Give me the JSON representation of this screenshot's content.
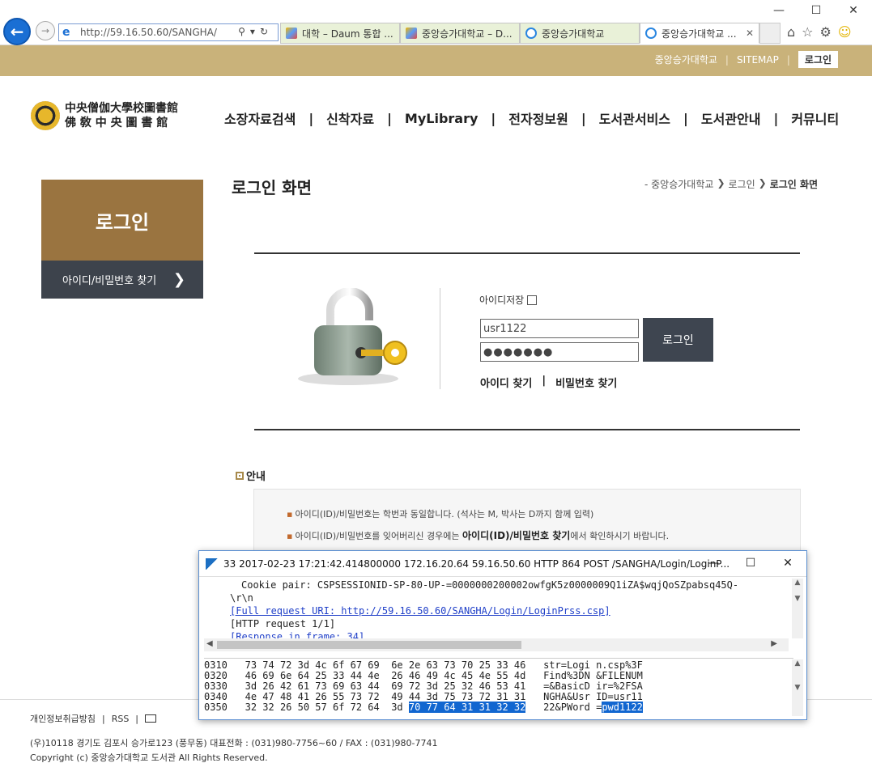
{
  "browser": {
    "url": "http://59.16.50.60/SANGHA/",
    "tabs": [
      {
        "label": "대학 – Daum 통합 ..."
      },
      {
        "label": "중앙승가대학교 – D..."
      },
      {
        "label": "중앙승가대학교"
      },
      {
        "label": "중앙승가대학교 ..."
      }
    ]
  },
  "topbar": {
    "university": "중앙승가대학교",
    "sitemap": "SITEMAP",
    "login": "로그인"
  },
  "logo": {
    "line1": "中央僧伽大學校圖書館",
    "line2": "佛 敎 中 央 圖 書 館"
  },
  "nav": [
    "소장자료검색",
    "신착자료",
    "MyLibrary",
    "전자정보원",
    "도서관서비스",
    "도서관안내",
    "커뮤니티"
  ],
  "side": {
    "title": "로그인",
    "item": "아이디/비밀번호 찾기"
  },
  "page": {
    "title": "로그인 화면",
    "breadcrumb": [
      "- 중앙승가대학교",
      "로그인",
      "로그인 화면"
    ]
  },
  "login_form": {
    "save_id_label": "아이디저장",
    "user_id": "usr1122",
    "password_masked": "●●●●●●●",
    "submit": "로그인",
    "find_id": "아이디 찾기",
    "find_pw": "비밀번호 찾기"
  },
  "notice": {
    "title": "안내",
    "line1": "아이디(ID)/비밀번호는 학번과 동일합니다. (석사는 M, 박사는 D까지 함께 입력)",
    "line2_pre": "아이디(ID)/비밀번호를 잊어버리신 경우에는 ",
    "line2_bold": "아이디(ID)/비밀번호 찾기",
    "line2_post": "에서 확인하시기 바랍니다."
  },
  "footer": {
    "privacy": "개인정보취급방침",
    "rss": "RSS",
    "address": "(우)10118 경기도 김포시 승가로123 (풍무동) 대표전화 : (031)980-7756~60 / FAX : (031)980-7741",
    "copyright": "Copyright (c) 중앙승가대학교 도서관 All Rights Reserved."
  },
  "packet_window": {
    "title": "33 2017-02-23 17:21:42.414800000 172.16.20.64 59.16.50.60 HTTP 864 POST /SANGHA/Login/LoginP...",
    "detail_lines": [
      "Cookie pair: CSPSESSIONID-SP-80-UP-=0000000200002owfgK5z0000009Q1iZA$wqjQoSZpabsq45Q-",
      "\\r\\n",
      "[Full request URI: http://59.16.50.60/SANGHA/Login/LoginPrss.csp]",
      "[HTTP request 1/1]",
      "[Response in frame: 34]"
    ],
    "hex_rows": [
      {
        "offset": "0310",
        "bytes": "73 74 72 3d 4c 6f 67 69  6e 2e 63 73 70 25 33 46",
        "ascii": "str=Logi n.csp%3F"
      },
      {
        "offset": "0320",
        "bytes": "46 69 6e 64 25 33 44 4e  26 46 49 4c 45 4e 55 4d",
        "ascii": "Find%3DN &FILENUM"
      },
      {
        "offset": "0330",
        "bytes": "3d 26 42 61 73 69 63 44  69 72 3d 25 32 46 53 41",
        "ascii": "=&BasicD ir=%2FSA"
      },
      {
        "offset": "0340",
        "bytes": "4e 47 48 41 26 55 73 72  49 44 3d 75 73 72 31 31",
        "ascii": "NGHA&Usr ID=usr11"
      },
      {
        "offset": "0350",
        "bytes_pre": "32 32 26 50 57 6f 72 64  3d ",
        "bytes_hl": "70 77 64 31 31 32 32",
        "ascii_pre": "22&PWord =",
        "ascii_hl": "pwd1122"
      }
    ]
  }
}
